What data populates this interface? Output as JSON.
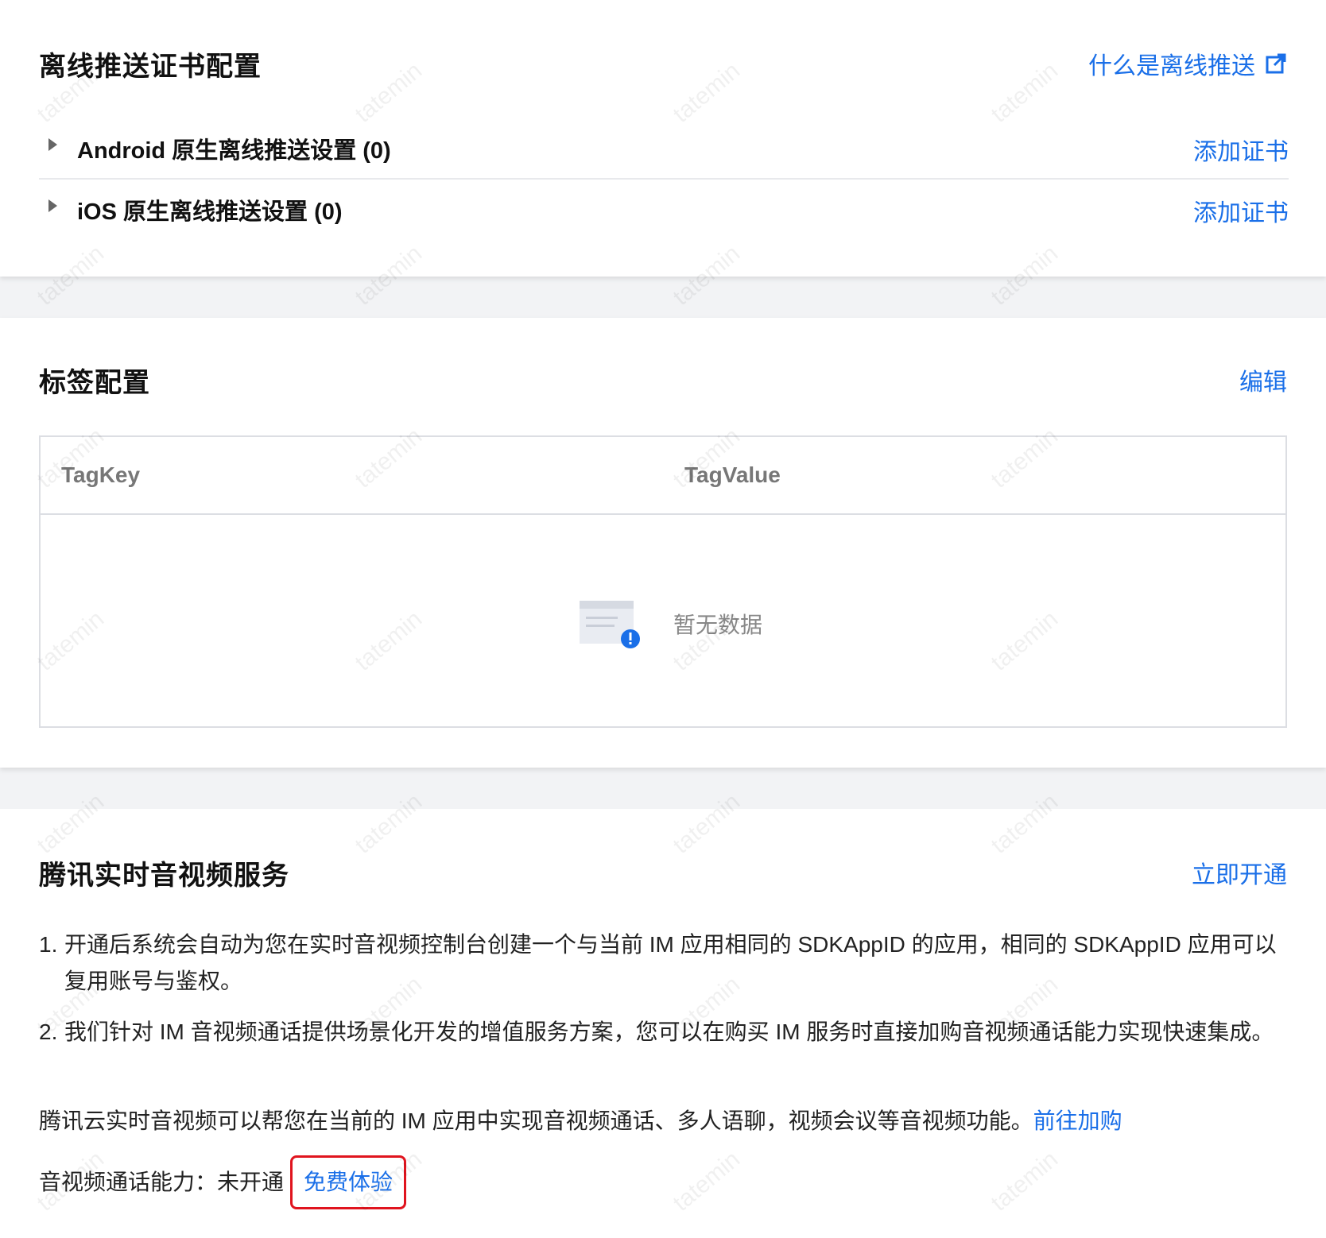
{
  "push": {
    "title": "离线推送证书配置",
    "what_link": "什么是离线推送",
    "rows": [
      {
        "label": "Android 原生离线推送设置 (0)",
        "action": "添加证书"
      },
      {
        "label": "iOS 原生离线推送设置 (0)",
        "action": "添加证书"
      }
    ]
  },
  "tags": {
    "title": "标签配置",
    "edit": "编辑",
    "columns": [
      "TagKey",
      "TagValue"
    ],
    "empty": "暂无数据"
  },
  "trtc": {
    "title": "腾讯实时音视频服务",
    "open": "立即开通",
    "items": [
      {
        "num": "1.",
        "text": "开通后系统会自动为您在实时音视频控制台创建一个与当前 IM 应用相同的 SDKAppID 的应用，相同的 SDKAppID 应用可以复用账号与鉴权。"
      },
      {
        "num": "2.",
        "text": "我们针对 IM 音视频通话提供场景化开发的增值服务方案，您可以在购买 IM 服务时直接加购音视频通话能力实现快速集成。"
      }
    ],
    "desc": "腾讯云实时音视频可以帮您在当前的 IM 应用中实现音视频通话、多人语聊，视频会议等音视频功能。",
    "desc_link": "前往加购",
    "ability_label": "音视频通话能力：",
    "ability_status": "未开通",
    "free_trial": "免费体验"
  },
  "watermark": "tatemin",
  "colors": {
    "link": "#1a6fe8",
    "highlight_border": "#e0141e",
    "badge": "#1a6fe8"
  }
}
